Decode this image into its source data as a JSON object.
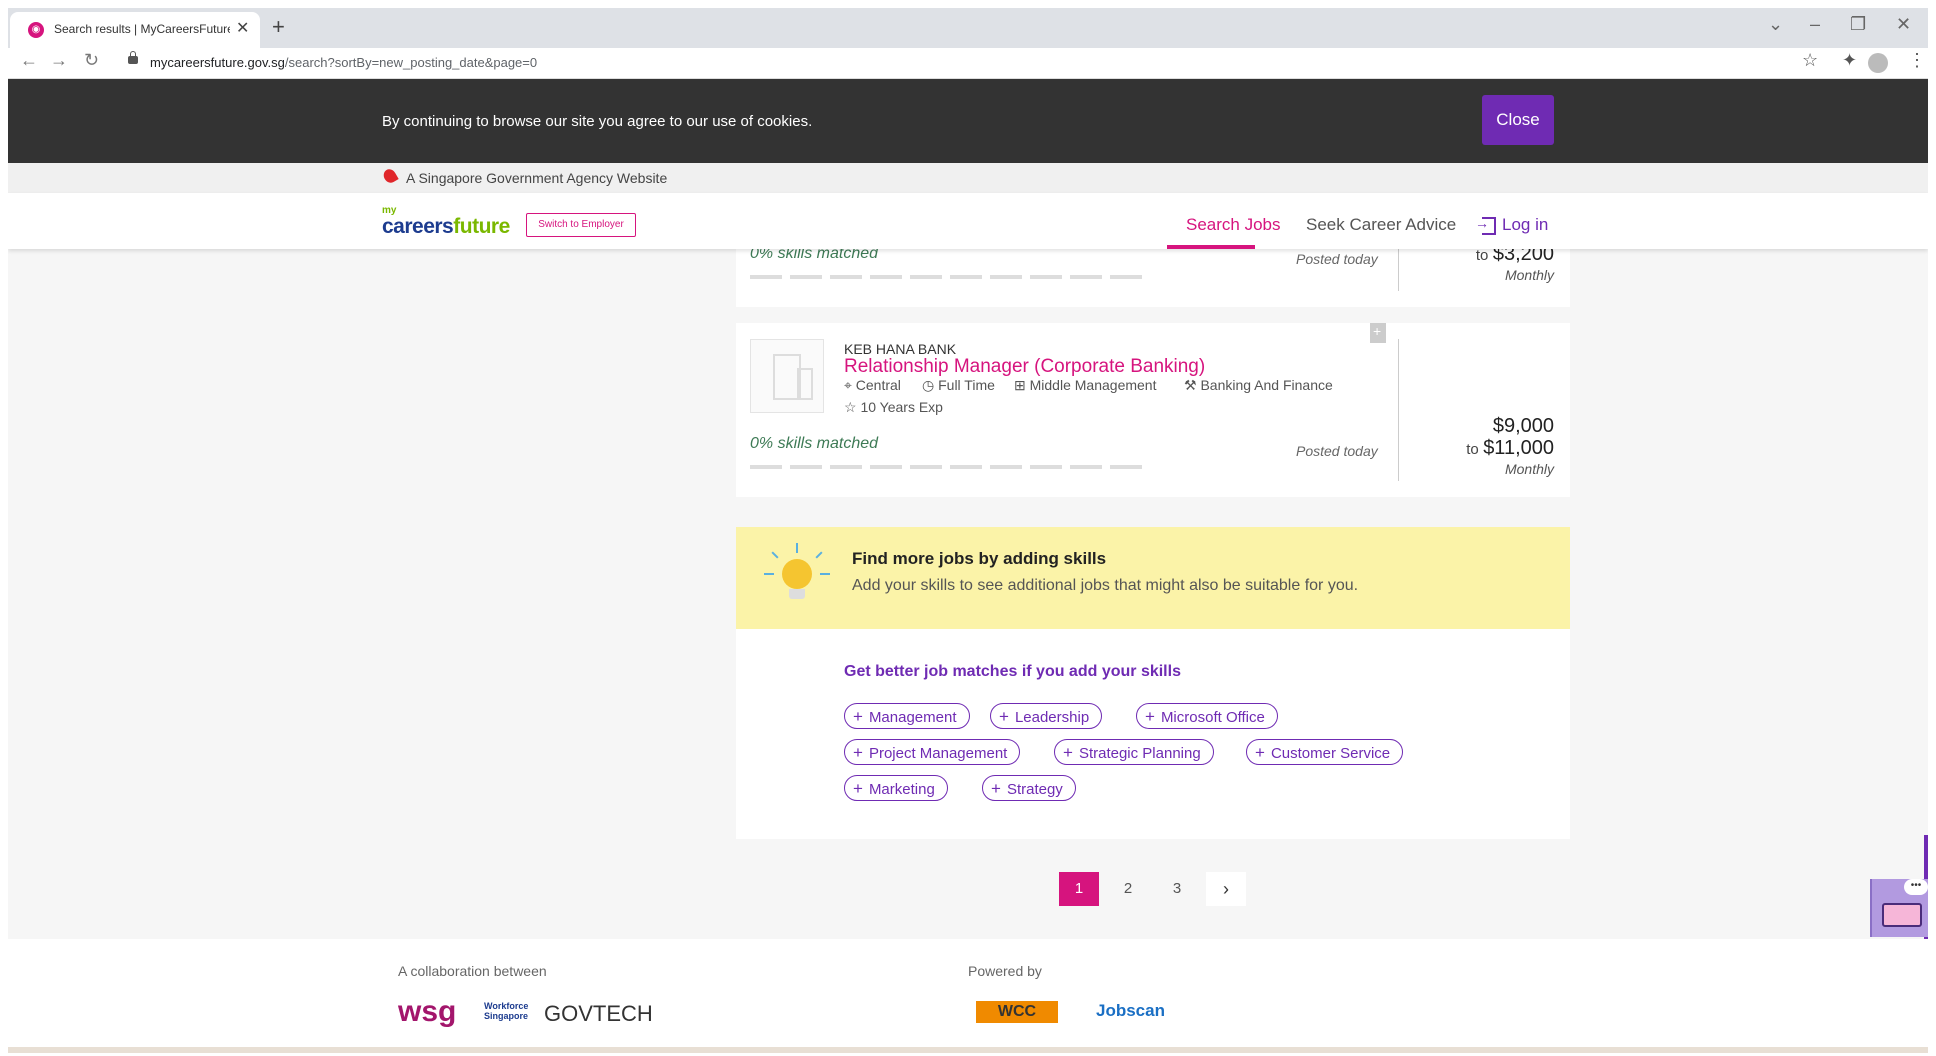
{
  "browser": {
    "tab_title": "Search results | MyCareersFuture",
    "tab_close": "✕",
    "new_tab": "+",
    "url_domain": "mycareersfuture.gov.sg",
    "url_path": "/search?sortBy=new_posting_date&page=0",
    "icons": [
      "back-icon",
      "forward-icon",
      "reload-icon",
      "lock-icon",
      "star-icon",
      "extensions-icon",
      "profile-icon",
      "menu-icon"
    ]
  },
  "cookie_banner": {
    "text": "By continuing to browse our site you agree to our use of cookies.",
    "close_label": "Close"
  },
  "gov_banner": {
    "text": "A Singapore Government Agency Website"
  },
  "header": {
    "logo_small": "my",
    "logo_part1": "careers",
    "logo_part2": "future",
    "switch_label": "Switch to Employer",
    "nav_search": "Search Jobs",
    "nav_advice": "Seek Career Advice",
    "nav_login": "Log in"
  },
  "job_top": {
    "skills_matched": "0% skills matched",
    "posted": "Posted today",
    "salary_to_prefix": "to",
    "salary_max": "$3,200",
    "salary_period": "Monthly"
  },
  "job_main": {
    "company": "KEB HANA BANK",
    "title": "Relationship Manager (Corporate Banking)",
    "location": "Central",
    "employment_type": "Full Time",
    "seniority": "Middle Management",
    "category": "Banking And Finance",
    "experience": "10 Years Exp",
    "skills_matched": "0% skills matched",
    "posted": "Posted today",
    "salary_min": "$9,000",
    "salary_to_prefix": "to",
    "salary_max": "$11,000",
    "salary_period": "Monthly"
  },
  "skills_banner": {
    "title": "Find more jobs by adding skills",
    "subtitle": "Add your skills to see additional jobs that might also be suitable for you."
  },
  "skills_section": {
    "heading": "Get better job matches if you add your skills",
    "chips": [
      "Management",
      "Leadership",
      "Microsoft Office",
      "Project Management",
      "Strategic Planning",
      "Customer Service",
      "Marketing",
      "Strategy"
    ]
  },
  "pagination": {
    "pages": [
      "1",
      "2",
      "3"
    ],
    "current": "1",
    "next": "›"
  },
  "footer": {
    "collab_label": "A collaboration between",
    "powered_label": "Powered by",
    "logo_wsg": "wsg",
    "logo_wsg_sub1": "Workforce",
    "logo_wsg_sub2": "Singapore",
    "logo_govtech": "GOVTECH",
    "logo_wcc": "WCC",
    "logo_jobscan": "Jobscan"
  },
  "colors": {
    "brand_pink": "#d6147e",
    "brand_purple": "#6f2bb3",
    "cookie_bg": "#333333",
    "banner_yellow": "#fbf3a8"
  }
}
